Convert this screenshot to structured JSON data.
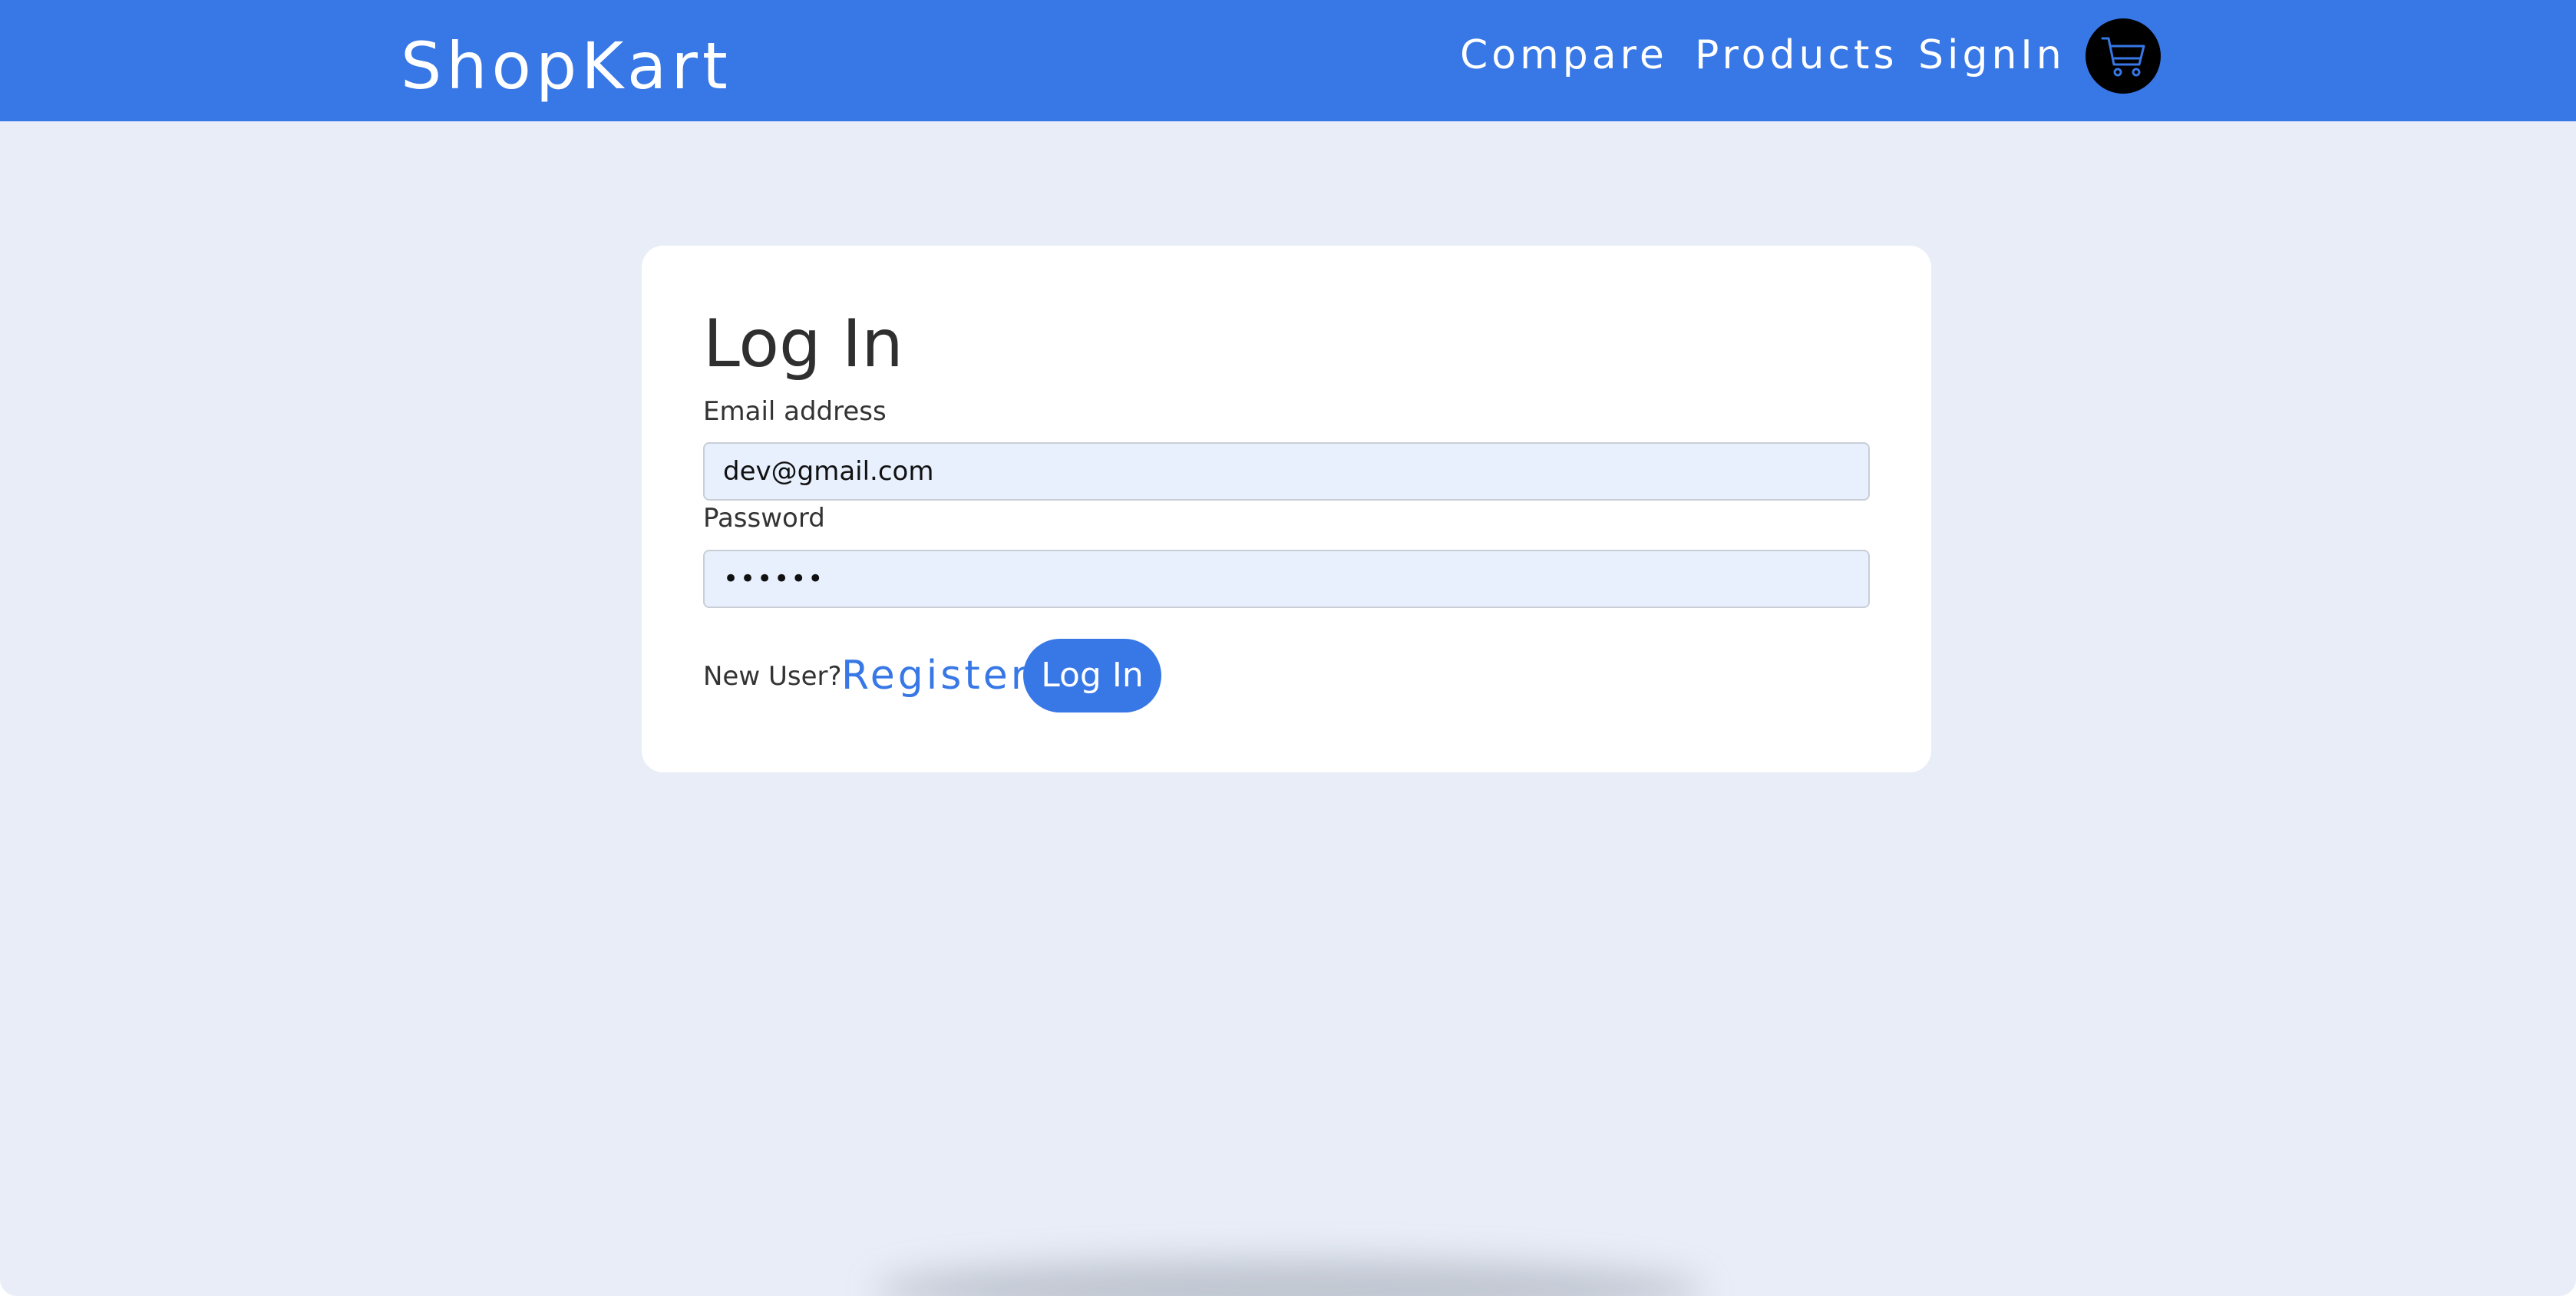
{
  "header": {
    "brand": "ShopKart",
    "nav": {
      "compare": "Compare",
      "products": "Products",
      "signin": "SignIn"
    },
    "cart_icon": "cart-icon"
  },
  "login_card": {
    "title": "Log In",
    "email_label": "Email address",
    "email_value": "dev@gmail.com",
    "password_label": "Password",
    "password_value": "••••••",
    "new_user_text": "New User?",
    "register_label": "Register",
    "login_button_label": "Log In"
  },
  "colors": {
    "primary": "#3777e6",
    "page_background": "#e8edf7",
    "card_background": "#ffffff",
    "input_background": "#e8f0fe",
    "cart_button": "#000000"
  }
}
